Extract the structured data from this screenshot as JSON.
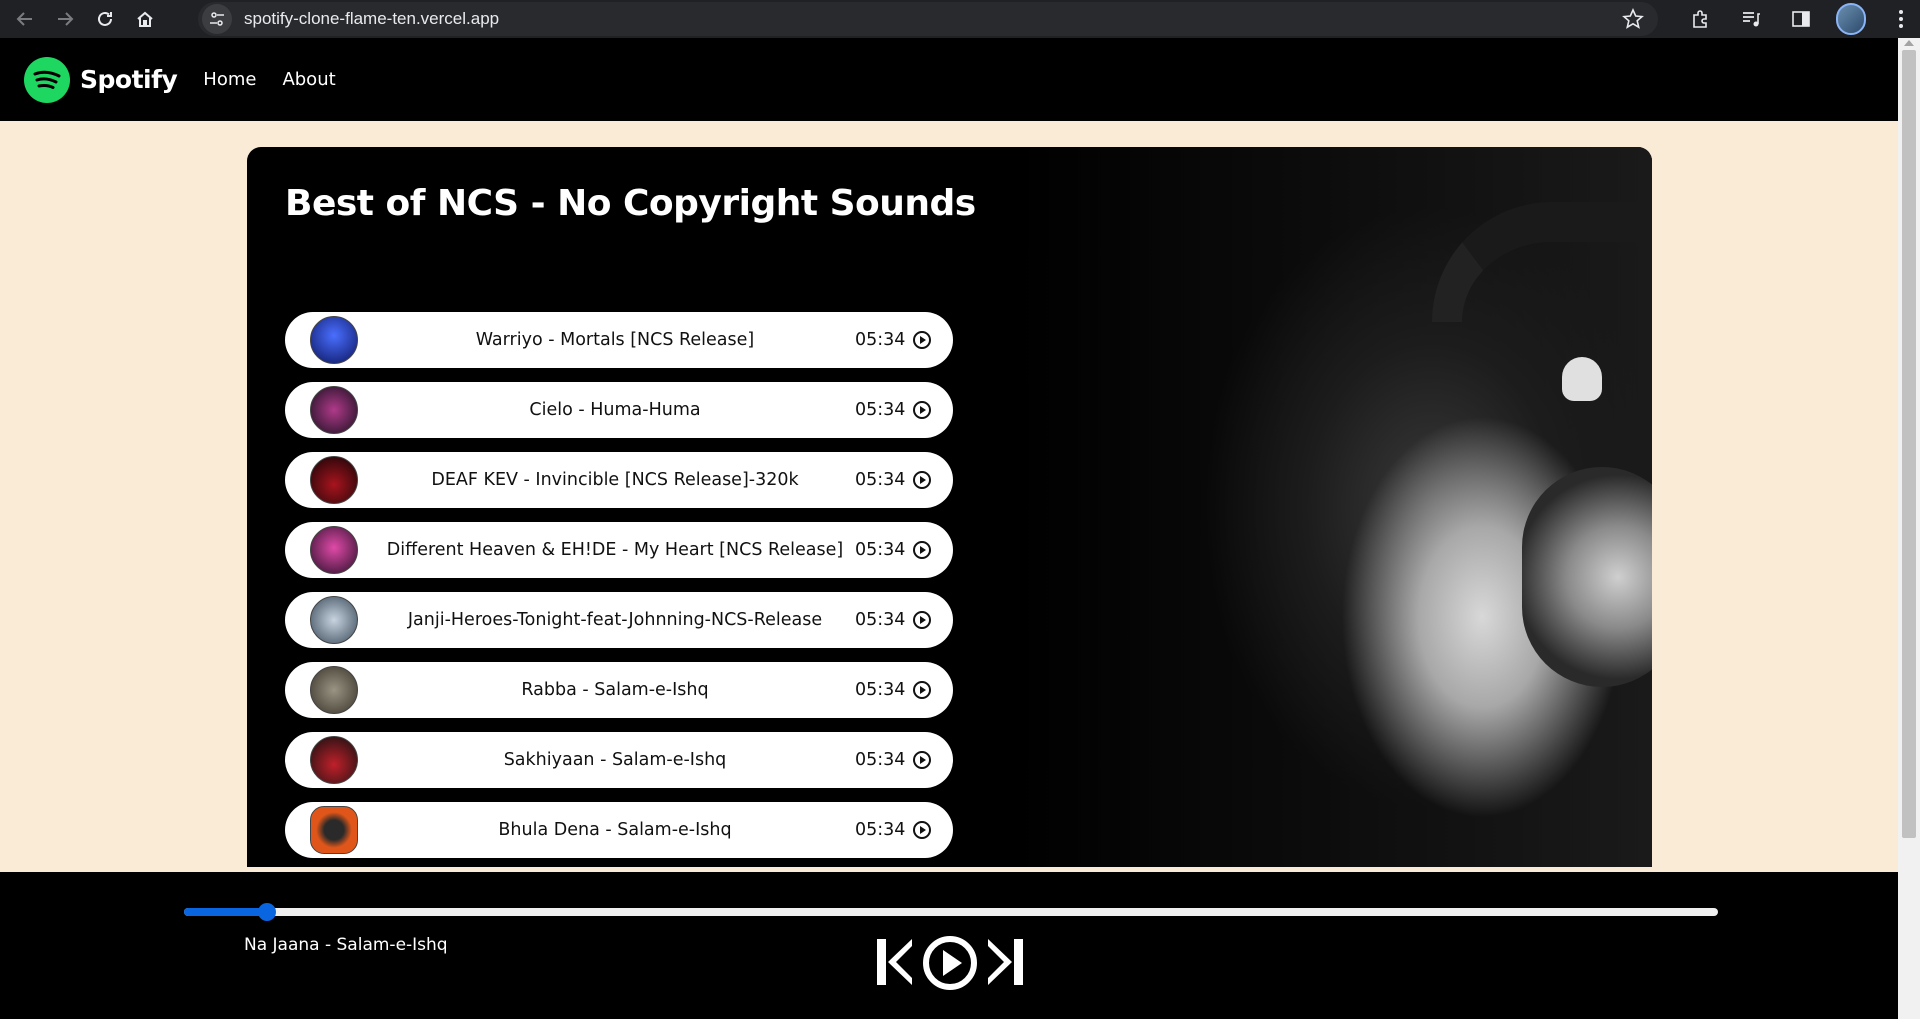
{
  "browser": {
    "url": "spotify-clone-flame-ten.vercel.app"
  },
  "navbar": {
    "brand": "Spotify",
    "links": [
      "Home",
      "About"
    ]
  },
  "playlist": {
    "title": "Best of NCS - No Copyright Sounds",
    "songs": [
      {
        "name": "Warriyo - Mortals [NCS Release]",
        "duration": "05:34",
        "thumb": "#1a2f9a"
      },
      {
        "name": "Cielo - Huma-Huma",
        "duration": "05:34",
        "thumb": "#3a1f4a"
      },
      {
        "name": "DEAF KEV - Invincible [NCS Release]-320k",
        "duration": "05:34",
        "thumb": "#5a0f14"
      },
      {
        "name": "Different Heaven & EH!DE - My Heart [NCS Release]",
        "duration": "05:34",
        "thumb": "#7a2f6a"
      },
      {
        "name": "Janji-Heroes-Tonight-feat-Johnning-NCS-Release",
        "duration": "05:34",
        "thumb": "#6a7f9a"
      },
      {
        "name": "Rabba - Salam-e-Ishq",
        "duration": "05:34",
        "thumb": "#5a5548"
      },
      {
        "name": "Sakhiyaan - Salam-e-Ishq",
        "duration": "05:34",
        "thumb": "#2a1a1a"
      },
      {
        "name": "Bhula Dena - Salam-e-Ishq",
        "duration": "05:34",
        "thumb": "#e0561a"
      }
    ]
  },
  "player": {
    "now_playing": "Na Jaana - Salam-e-Ishq",
    "progress_fraction": 0.054
  },
  "colors": {
    "accent": "#1ed760",
    "seek": "#0a66e0",
    "page_bg": "#faebd7"
  }
}
